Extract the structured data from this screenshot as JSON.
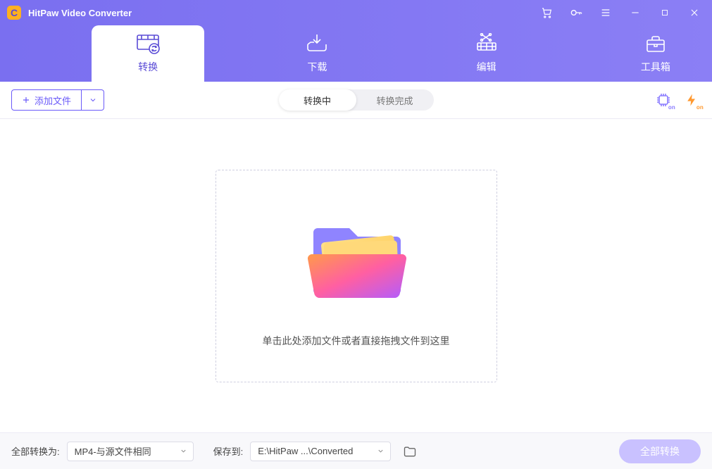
{
  "app": {
    "title": "HitPaw Video Converter"
  },
  "nav": {
    "tabs": [
      {
        "label": "转换"
      },
      {
        "label": "下载"
      },
      {
        "label": "编辑"
      },
      {
        "label": "工具箱"
      }
    ]
  },
  "toolbar": {
    "add_label": "添加文件",
    "seg_converting": "转换中",
    "seg_done": "转换完成",
    "gpu_on": "on",
    "accel_on": "on"
  },
  "drop": {
    "hint": "单击此处添加文件或者直接拖拽文件到这里"
  },
  "bottom": {
    "convert_all_to_label": "全部转换为:",
    "format_value": "MP4-与源文件相同",
    "save_to_label": "保存到:",
    "save_to_value": "E:\\HitPaw ...\\Converted",
    "convert_all_btn": "全部转换"
  }
}
